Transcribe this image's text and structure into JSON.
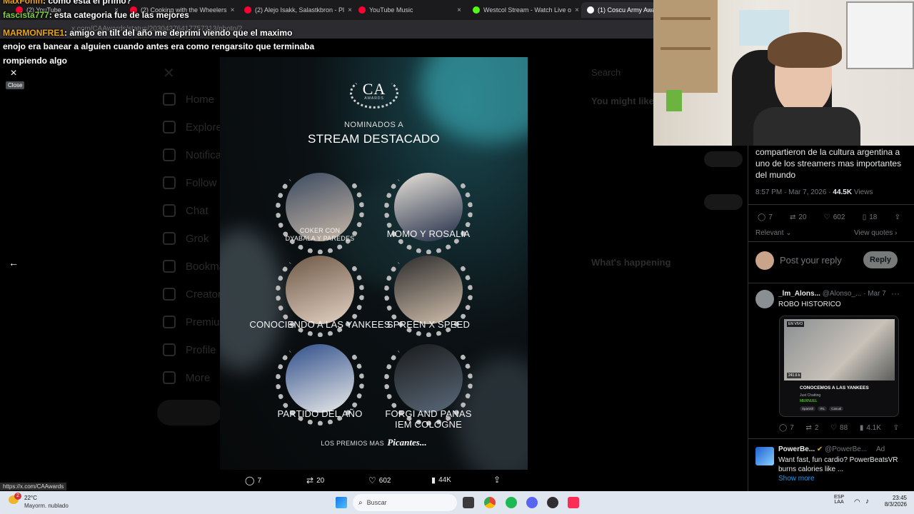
{
  "browser": {
    "tabs": [
      {
        "label": "(2) YouTube",
        "color": "#ff0033"
      },
      {
        "label": "(2) Cooking with the Wheelers",
        "color": "#ff0033"
      },
      {
        "label": "(2) Alejo Isakk, Salastkbron - Pl",
        "color": "#ff0033"
      },
      {
        "label": "YouTube Music",
        "color": "#ff0033"
      },
      {
        "label": "Westcol Stream - Watch Live o",
        "color": "#53fc18"
      },
      {
        "label": "(1) Coscu Army Awar",
        "color": "#ffffff"
      }
    ],
    "address": "x.com/CAAwards/status/20304376417757313/photo/2"
  },
  "chat": {
    "lines": [
      {
        "user": "MaxFonin",
        "text": ": como esta el primo?"
      },
      {
        "user": "fascista777",
        "text": ": esta categoria fue de las mejores"
      },
      {
        "user": "MARMONFRE1",
        "text": ": amigo en tilt del año me deprimi viendo que el maximo"
      },
      {
        "user": "",
        "text": "enojo era banear a alguien cuando antes era como rengarsito que terminaba"
      },
      {
        "user": "",
        "text": "rompiendo algo"
      }
    ]
  },
  "modal": {
    "close_label": "×",
    "close_tooltip": "Close",
    "back_icon": "arrow-left-icon",
    "logo_text": "CA",
    "logo_sub": "AWARDS",
    "nominated_label": "NOMINADOS A",
    "category_title": "STREAM DESTACADO",
    "nominees": [
      {
        "name": "COKER CON DYABALA Y PAREDES"
      },
      {
        "name": "MOMO Y ROSALIA"
      },
      {
        "name": "CONOCIENDO A LAS YANKEES"
      },
      {
        "name": "SPREEN X SPEED"
      },
      {
        "name": "PARTIDO DEL AÑO"
      },
      {
        "name": "FORGI AND PANAS IEM COLOGNE"
      }
    ],
    "footer_text": "LOS PREMIOS MAS",
    "footer_emph": "Picantes...",
    "actions": {
      "replies": "7",
      "reposts": "20",
      "likes": "602",
      "views": "44K"
    }
  },
  "sidebar_nav": [
    "Home",
    "Explore",
    "Notifications",
    "Follow",
    "Chat",
    "Grok",
    "Bookmarks",
    "Creator Studio",
    "Premium",
    "Profile",
    "More"
  ],
  "tweet": {
    "text": "compartieron de la cultura argentina a uno de los streamers mas importantes del mundo",
    "time": "8:57 PM · Mar 7, 2026 ·",
    "views_count": "44.5K",
    "views_label": "Views",
    "stats": {
      "replies": "7",
      "reposts": "20",
      "likes": "602",
      "bookmarks": "18"
    },
    "sort_label": "Relevant",
    "view_quotes": "View quotes",
    "reply_placeholder": "Post your reply",
    "reply_button": "Reply"
  },
  "reply1": {
    "name": "_lm_Alons...",
    "handle": "@Alonso_...",
    "date": "· Mar 7",
    "text": "ROBO HISTORICO",
    "embed": {
      "live_badge": "EN VIVO",
      "viewers": "241.6 k",
      "title": "CONOCEMOS A LAS YANKEES",
      "category": "Just Chatting",
      "channel": "MERNUEL",
      "tags": [
        "Spanish",
        "IRL",
        "Casual"
      ]
    },
    "stats": {
      "replies": "7",
      "reposts": "2",
      "likes": "88",
      "views": "4.1K"
    }
  },
  "ad": {
    "name": "PowerBe...",
    "handle": "@PowerBe...",
    "ad_label": "Ad",
    "text": "Want fast, fun cardio? PowerBeatsVR burns calories like ...",
    "show_more": "Show more"
  },
  "status_url": "https://x.com/CAAwards",
  "taskbar": {
    "temp": "22°C",
    "weather": "Mayorm. nublado",
    "search_placeholder": "Buscar",
    "lang": "ESP",
    "lang2": "LAA",
    "time": "23:45",
    "date": "8/3/2026",
    "weather_badge": "2"
  }
}
